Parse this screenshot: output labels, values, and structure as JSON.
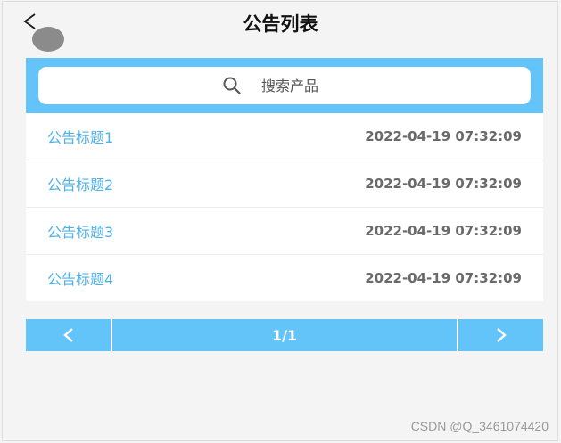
{
  "header": {
    "title": "公告列表",
    "back_icon": "back-chevron-icon"
  },
  "search": {
    "placeholder": "搜索产品",
    "icon": "search-icon"
  },
  "announcements": [
    {
      "title": "公告标题1",
      "datetime": "2022-04-19 07:32:09"
    },
    {
      "title": "公告标题2",
      "datetime": "2022-04-19 07:32:09"
    },
    {
      "title": "公告标题3",
      "datetime": "2022-04-19 07:32:09"
    },
    {
      "title": "公告标题4",
      "datetime": "2022-04-19 07:32:09"
    }
  ],
  "pagination": {
    "page_info": "1/1",
    "prev_icon": "chevron-left-icon",
    "next_icon": "chevron-right-icon"
  },
  "watermark": {
    "text": "CSDN @Q_3461074420"
  },
  "colors": {
    "accent": "#63c4fa",
    "link_text": "#4eb2e8",
    "date_text": "#6a6a6a",
    "background": "#f4f4f4"
  }
}
